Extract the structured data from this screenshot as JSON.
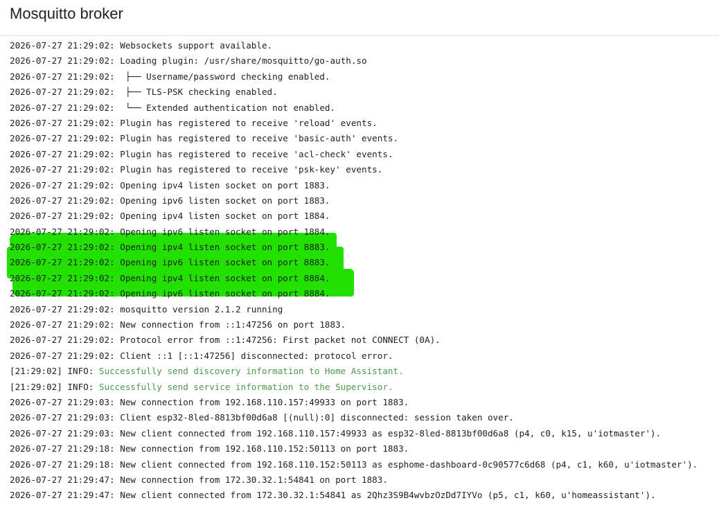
{
  "header": {
    "title": "Mosquitto broker"
  },
  "highlight_color": "#22e000",
  "info_color": "#4a9a4a",
  "log": {
    "lines": [
      {
        "prefix": "2026-07-27 21:29:02: ",
        "msg": "Websockets support available."
      },
      {
        "prefix": "2026-07-27 21:29:02: ",
        "msg": "Loading plugin: /usr/share/mosquitto/go-auth.so"
      },
      {
        "prefix": "2026-07-27 21:29:02: ",
        "msg": " ├── Username/password checking enabled."
      },
      {
        "prefix": "2026-07-27 21:29:02: ",
        "msg": " ├── TLS-PSK checking enabled."
      },
      {
        "prefix": "2026-07-27 21:29:02: ",
        "msg": " └── Extended authentication not enabled."
      },
      {
        "prefix": "2026-07-27 21:29:02: ",
        "msg": "Plugin has registered to receive 'reload' events."
      },
      {
        "prefix": "2026-07-27 21:29:02: ",
        "msg": "Plugin has registered to receive 'basic-auth' events."
      },
      {
        "prefix": "2026-07-27 21:29:02: ",
        "msg": "Plugin has registered to receive 'acl-check' events."
      },
      {
        "prefix": "2026-07-27 21:29:02: ",
        "msg": "Plugin has registered to receive 'psk-key' events."
      },
      {
        "prefix": "2026-07-27 21:29:02: ",
        "msg": "Opening ipv4 listen socket on port 1883."
      },
      {
        "prefix": "2026-07-27 21:29:02: ",
        "msg": "Opening ipv6 listen socket on port 1883."
      },
      {
        "prefix": "2026-07-27 21:29:02: ",
        "msg": "Opening ipv4 listen socket on port 1884."
      },
      {
        "prefix": "2026-07-27 21:29:02: ",
        "msg": "Opening ipv6 listen socket on port 1884."
      },
      {
        "prefix": "2026-07-27 21:29:02: ",
        "msg": "Opening ipv4 listen socket on port 8883."
      },
      {
        "prefix": "2026-07-27 21:29:02: ",
        "msg": "Opening ipv6 listen socket on port 8883."
      },
      {
        "prefix": "2026-07-27 21:29:02: ",
        "msg": "Opening ipv4 listen socket on port 8884."
      },
      {
        "prefix": "2026-07-27 21:29:02: ",
        "msg": "Opening ipv6 listen socket on port 8884."
      },
      {
        "prefix": "2026-07-27 21:29:02: ",
        "msg": "mosquitto version 2.1.2 running"
      },
      {
        "prefix": "2026-07-27 21:29:02: ",
        "msg": "New connection from ::1:47256 on port 1883."
      },
      {
        "prefix": "2026-07-27 21:29:02: ",
        "msg": "Protocol error from ::1:47256: First packet not CONNECT (0A)."
      },
      {
        "prefix": "2026-07-27 21:29:02: ",
        "msg": "Client ::1 [::1:47256] disconnected: protocol error."
      },
      {
        "prefix": "[21:29:02] INFO: ",
        "msg": "Successfully send discovery information to Home Assistant.",
        "level": "info"
      },
      {
        "prefix": "[21:29:02] INFO: ",
        "msg": "Successfully send service information to the Supervisor.",
        "level": "info"
      },
      {
        "prefix": "2026-07-27 21:29:03: ",
        "msg": "New connection from 192.168.110.157:49933 on port 1883."
      },
      {
        "prefix": "2026-07-27 21:29:03: ",
        "msg": "Client esp32-8led-8813bf00d6a8 [(null):0] disconnected: session taken over."
      },
      {
        "prefix": "2026-07-27 21:29:03: ",
        "msg": "New client connected from 192.168.110.157:49933 as esp32-8led-8813bf00d6a8 (p4, c0, k15, u'iotmaster')."
      },
      {
        "prefix": "2026-07-27 21:29:18: ",
        "msg": "New connection from 192.168.110.152:50113 on port 1883."
      },
      {
        "prefix": "2026-07-27 21:29:18: ",
        "msg": "New client connected from 192.168.110.152:50113 as esphome-dashboard-0c90577c6d68 (p4, c1, k60, u'iotmaster')."
      },
      {
        "prefix": "2026-07-27 21:29:47: ",
        "msg": "New connection from 172.30.32.1:54841 on port 1883."
      },
      {
        "prefix": "2026-07-27 21:29:47: ",
        "msg": "New client connected from 172.30.32.1:54841 as 2Qhz3S9B4wvbzOzDd7IYVo (p5, c1, k60, u'homeassistant')."
      }
    ]
  }
}
